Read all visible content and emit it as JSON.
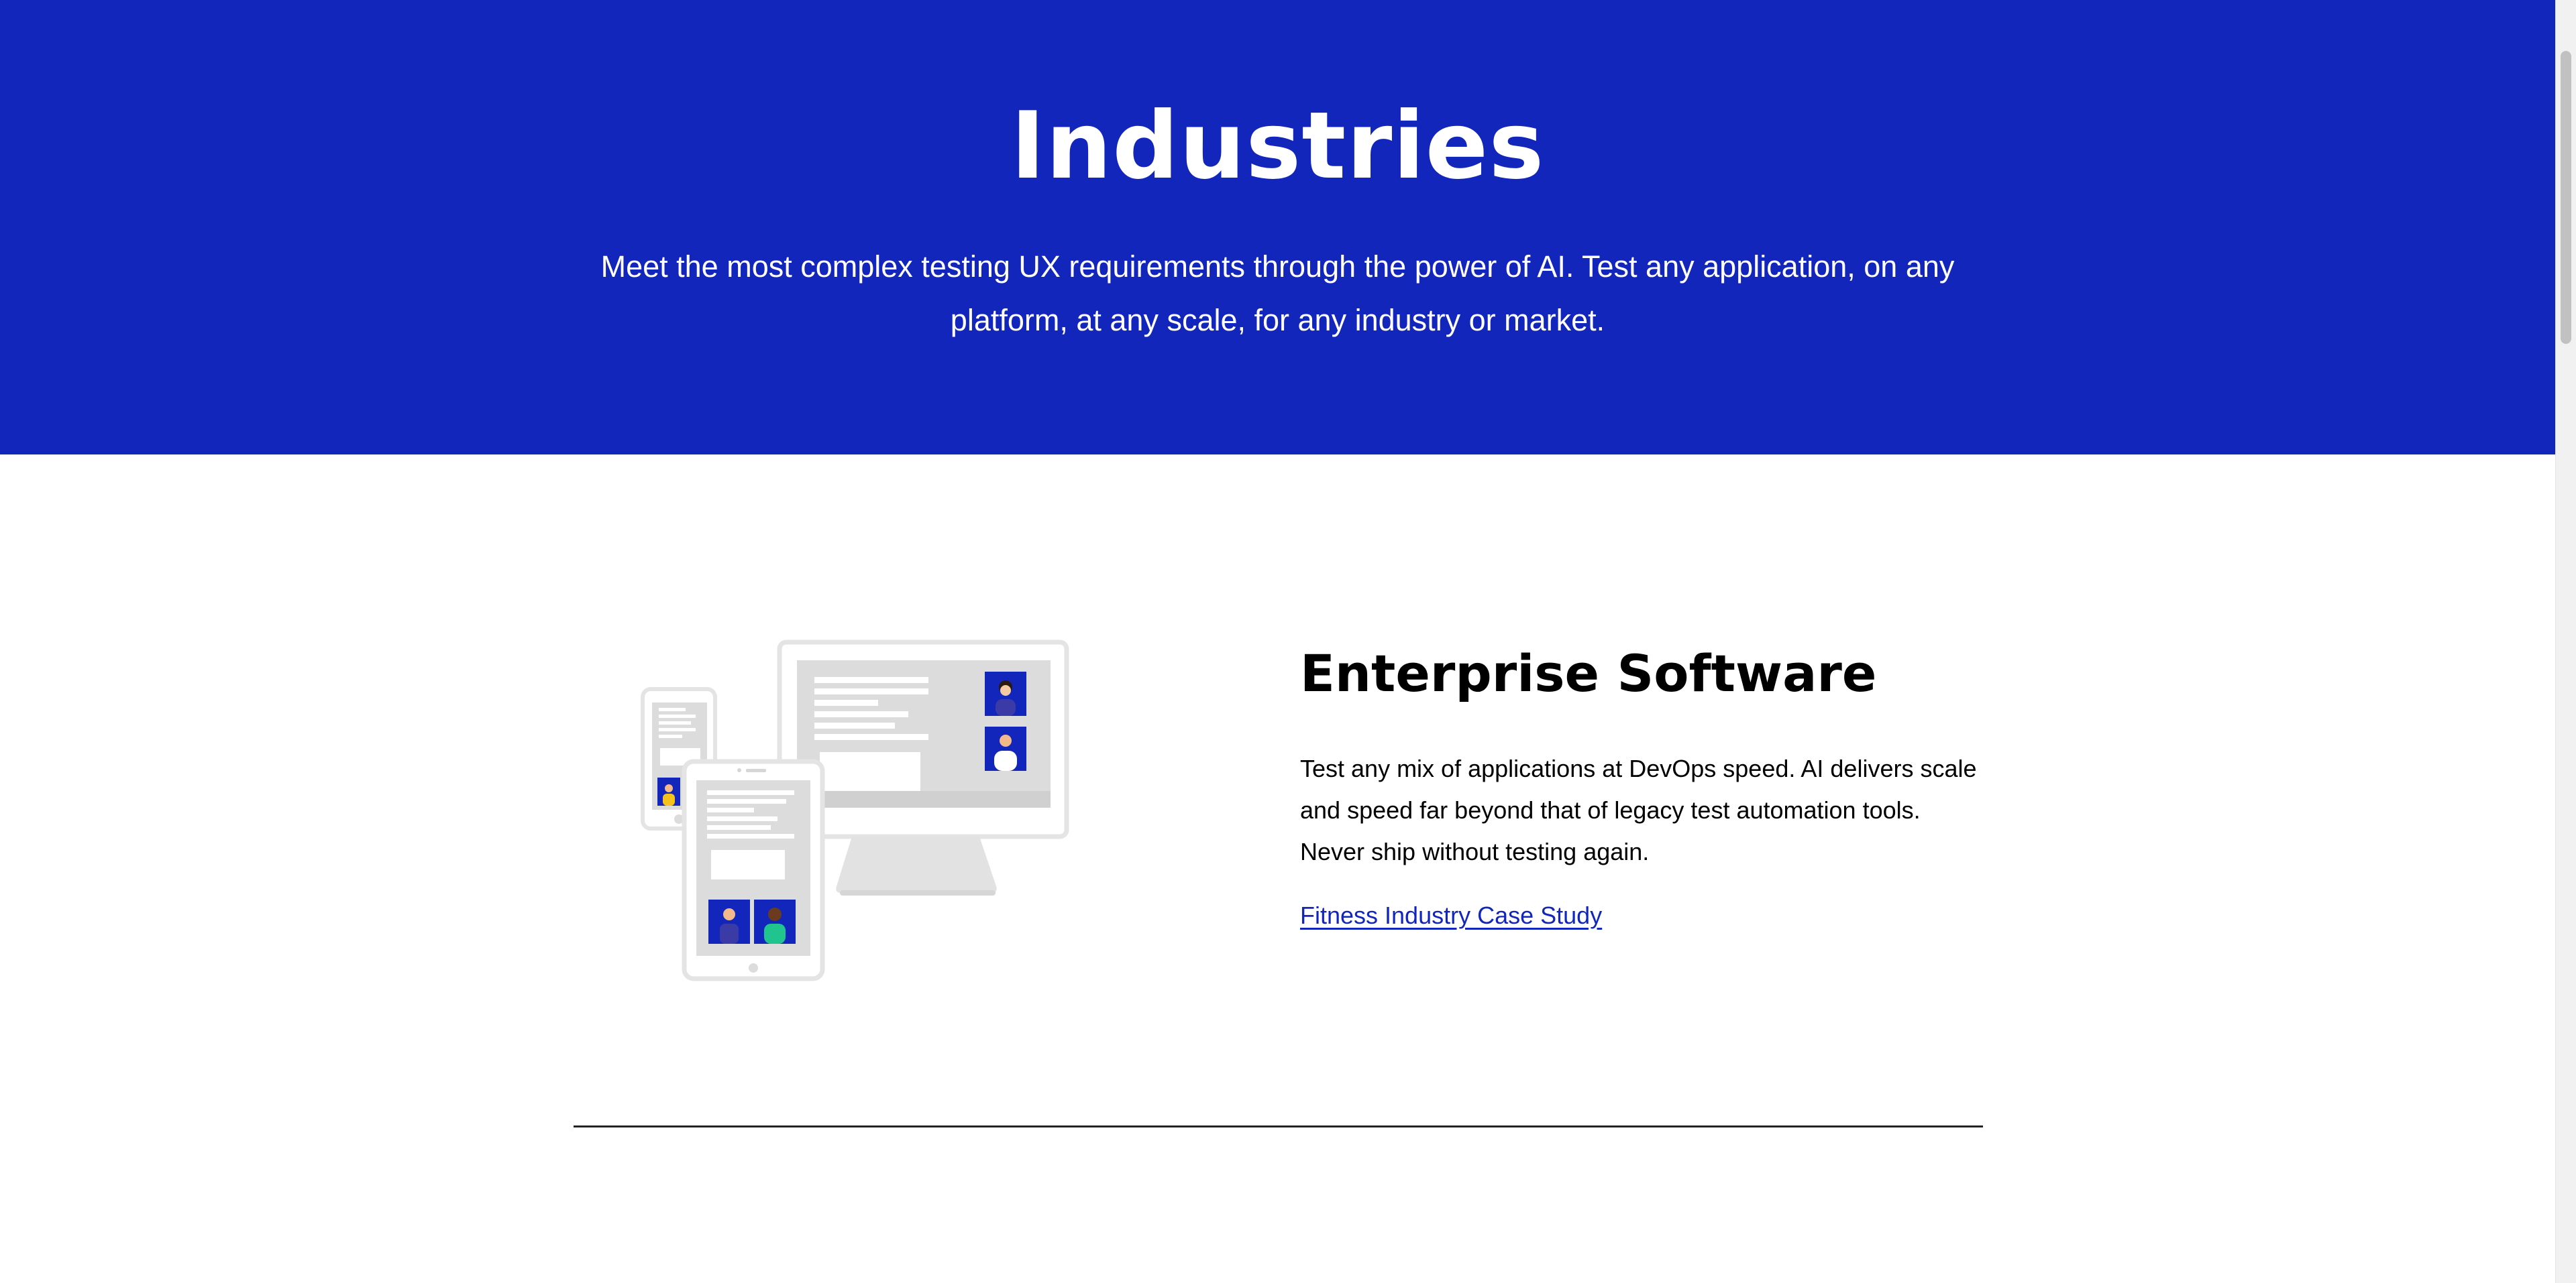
{
  "hero": {
    "title": "Industries",
    "subtitle": "Meet the most complex testing UX requirements through the power of AI. Test any application, on any platform, at any scale, for any industry or market."
  },
  "section": {
    "title": "Enterprise Software",
    "body": "Test any mix of applications at DevOps speed. AI delivers scale and speed far beyond that of legacy test automation tools. Never ship without testing again.",
    "link_label": "Fitness Industry Case Study"
  },
  "colors": {
    "brand_blue": "#1226bc",
    "white": "#ffffff",
    "text": "#000000"
  },
  "icons": {
    "illustration": "multi-device-illustration"
  }
}
